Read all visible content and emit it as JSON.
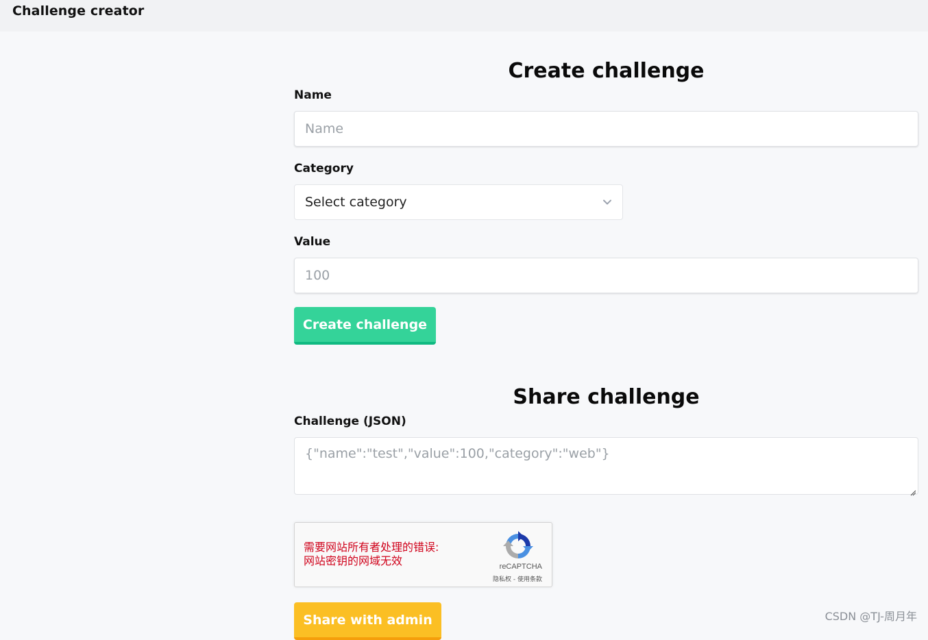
{
  "header": {
    "app_title": "Challenge creator"
  },
  "create_section": {
    "title": "Create challenge",
    "name_label": "Name",
    "name_placeholder": "Name",
    "category_label": "Category",
    "category_selected": "Select category",
    "value_label": "Value",
    "value_placeholder": "100",
    "submit_label": "Create challenge"
  },
  "share_section": {
    "title": "Share challenge",
    "json_label": "Challenge (JSON)",
    "json_placeholder": "{\"name\":\"test\",\"value\":100,\"category\":\"web\"}",
    "submit_label": "Share with admin"
  },
  "recaptcha": {
    "error_line1": "需要网站所有者处理的错误:",
    "error_line2": "网站密钥的网域无效",
    "brand": "reCAPTCHA",
    "links": "隐私权 - 使用条款"
  },
  "watermark": "CSDN @TJ-周月年",
  "colors": {
    "create_button": "#34d399",
    "share_button": "#fbbf24",
    "recaptcha_error": "#d0021b"
  },
  "icons": {
    "category_dropdown": "chevron-down-icon",
    "recaptcha_logo": "recaptcha-logo-icon",
    "textarea_resize": "resize-handle-icon"
  }
}
